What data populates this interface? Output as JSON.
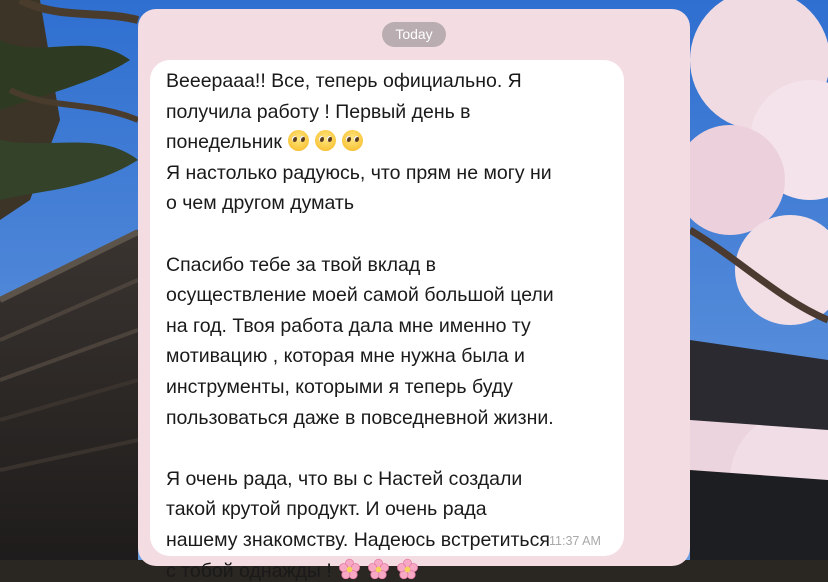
{
  "chat": {
    "date_separator": "Today",
    "message": {
      "lines": [
        "Вееерааа!! Все, теперь официально. Я",
        "получила работу ! Первый день в",
        "понедельник",
        "Я настолько радуюсь, что прям не могу ни",
        "о чем другом думать",
        "",
        "Спасибо тебе за твой вклад в",
        "осуществление моей самой большой цели",
        "на год. Твоя работа дала мне именно ту",
        "мотивацию , которая мне нужна была и",
        "инструменты, которыми я теперь буду",
        "пользоваться даже в повседневной жизни.",
        "",
        "Я очень рада, что вы с Настей создали",
        "такой крутой продукт. И очень рада",
        "нашему знакомству. Надеюсь встретиться",
        "с тобой однажды !"
      ],
      "line3_emojis": [
        "pleading-face-emoji",
        "pleading-face-emoji",
        "pleading-face-emoji"
      ],
      "last_line_emojis": [
        "cherry-blossom-emoji",
        "cherry-blossom-emoji",
        "cherry-blossom-emoji"
      ],
      "time": "11:37 AM"
    }
  },
  "colors": {
    "panel_background": "#f3dde2",
    "bubble_background": "#ffffff",
    "date_chip": "#b9adb1",
    "timestamp": "#a8a8a8",
    "text": "#1a1a1a"
  }
}
